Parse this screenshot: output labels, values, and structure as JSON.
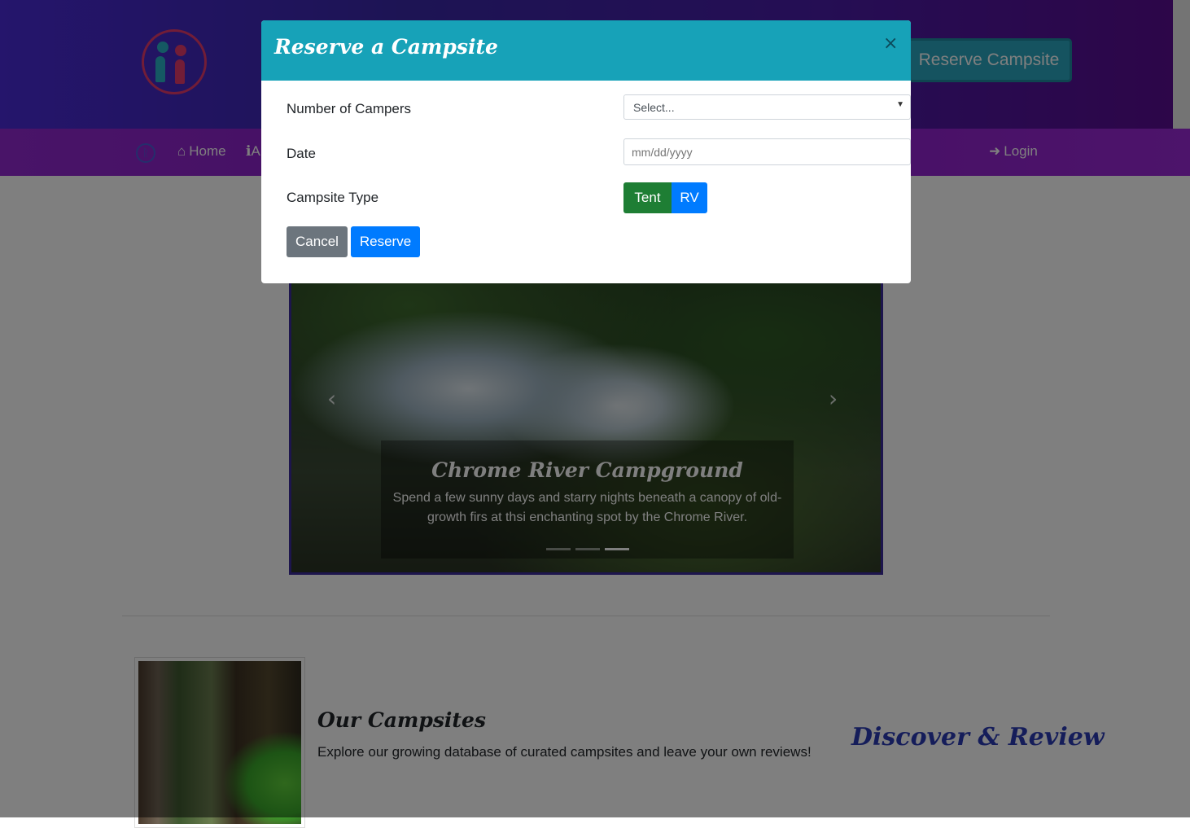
{
  "header": {
    "reserve_button_label": "Reserve Campsite"
  },
  "nav": {
    "home_label": "Home",
    "about_label": "A",
    "login_label": "Login"
  },
  "carousel": {
    "caption_title": "Chrome River Campground",
    "caption_text": "Spend a few sunny days and starry nights beneath a canopy of old-growth firs at thsi enchanting spot by the Chrome River.",
    "active_slide": 3,
    "slide_count": 3
  },
  "campsites": {
    "heading": "Our Campsites",
    "description": "Explore our growing database of curated campsites and leave your own reviews!",
    "tagline": "Discover & Review"
  },
  "modal": {
    "title": "Reserve a Campsite",
    "close_symbol": "×",
    "campers_label": "Number of Campers",
    "campers_value": "Select...",
    "date_label": "Date",
    "date_placeholder": "mm/dd/yyyy",
    "type_label": "Campsite Type",
    "type_options": [
      "Tent",
      "RV"
    ],
    "cancel_label": "Cancel",
    "reserve_label": "Reserve"
  },
  "colors": {
    "modal_header": "#17a2b8",
    "tent_active": "#1e7e34",
    "rv": "#007bff",
    "cancel": "#6c757d",
    "reserve": "#007bff"
  }
}
